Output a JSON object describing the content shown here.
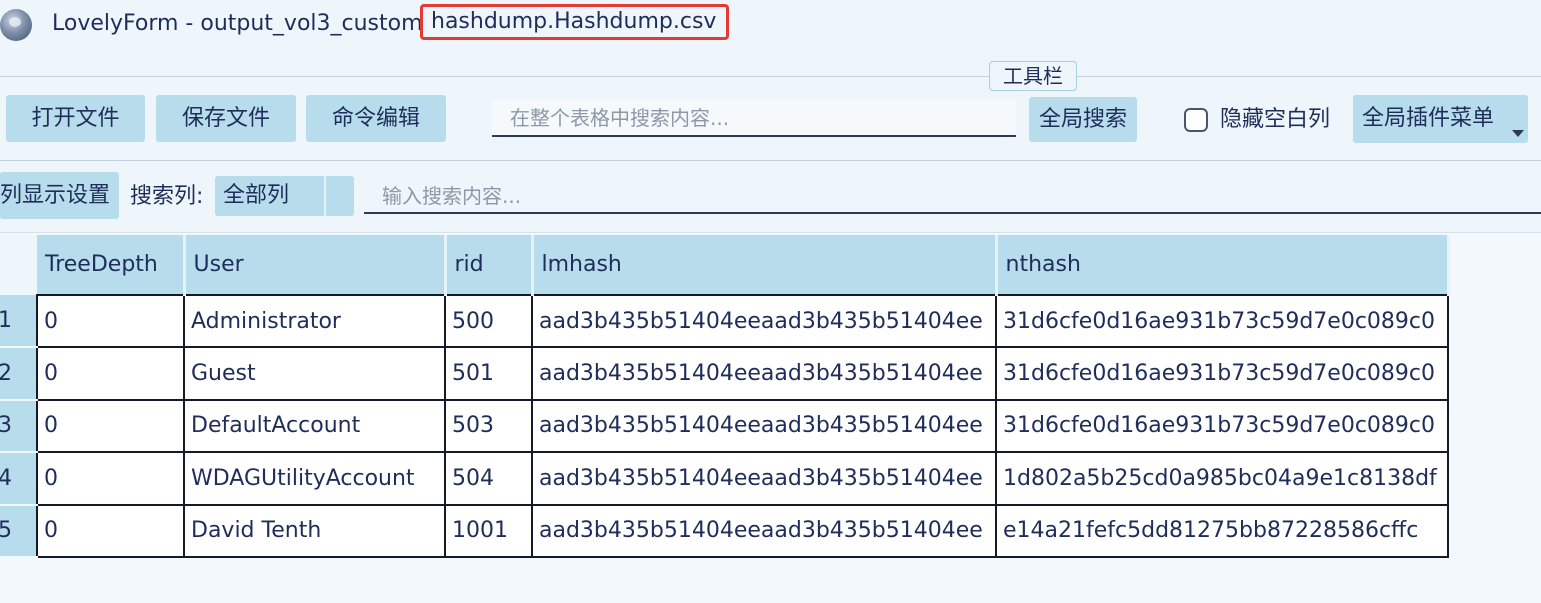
{
  "window": {
    "title_prefix": "LovelyForm - output_vol3_custom",
    "title_file": "hashdump.Hashdump.csv"
  },
  "toolbar": {
    "label": "工具栏",
    "open_file": "打开文件",
    "save_file": "保存文件",
    "command_edit": "命令编辑",
    "global_search_placeholder": "在整个表格中搜索内容...",
    "global_search_button": "全局搜索",
    "hide_empty_columns": "隐藏空白列",
    "hide_empty_columns_checked": false,
    "plugin_menu": "全局插件菜单"
  },
  "filter": {
    "column_display_settings": "列显示设置",
    "search_column_label": "搜索列:",
    "search_column_value": "全部列",
    "search_placeholder": "输入搜索内容..."
  },
  "table": {
    "columns": [
      "TreeDepth",
      "User",
      "rid",
      "lmhash",
      "nthash"
    ],
    "rows": [
      {
        "num": "1",
        "cells": [
          "0",
          "Administrator",
          "500",
          "aad3b435b51404eeaad3b435b51404ee",
          "31d6cfe0d16ae931b73c59d7e0c089c0"
        ]
      },
      {
        "num": "2",
        "cells": [
          "0",
          "Guest",
          "501",
          "aad3b435b51404eeaad3b435b51404ee",
          "31d6cfe0d16ae931b73c59d7e0c089c0"
        ]
      },
      {
        "num": "3",
        "cells": [
          "0",
          "DefaultAccount",
          "503",
          "aad3b435b51404eeaad3b435b51404ee",
          "31d6cfe0d16ae931b73c59d7e0c089c0"
        ]
      },
      {
        "num": "4",
        "cells": [
          "0",
          "WDAGUtilityAccount",
          "504",
          "aad3b435b51404eeaad3b435b51404ee",
          "1d802a5b25cd0a985bc04a9e1c8138df"
        ]
      },
      {
        "num": "5",
        "cells": [
          "0",
          "David Tenth",
          "1001",
          "aad3b435b51404eeaad3b435b51404ee",
          "e14a21fefc5dd81275bb87228586cffc"
        ]
      }
    ]
  }
}
